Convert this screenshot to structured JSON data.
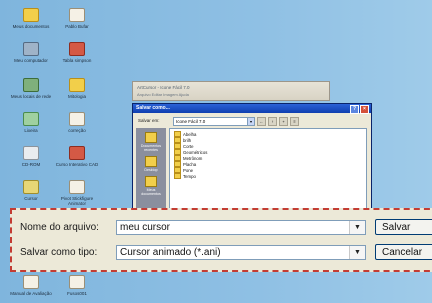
{
  "desktop_icons": [
    {
      "label": "Meus documentos",
      "kind": "folder"
    },
    {
      "label": "Pablo Bufar",
      "kind": "doc"
    },
    {
      "label": "Meu computador",
      "kind": "pc"
    },
    {
      "label": "Tabla simpson",
      "kind": "red"
    },
    {
      "label": "Meus locais de rede",
      "kind": "net"
    },
    {
      "label": "Mitologia",
      "kind": "folder"
    },
    {
      "label": "Lixeira",
      "kind": "trash"
    },
    {
      "label": "correção",
      "kind": "doc"
    },
    {
      "label": "CD-ROM",
      "kind": "cd"
    },
    {
      "label": "Curso Interativo CAD",
      "kind": "red"
    },
    {
      "label": "Cursor",
      "kind": "cursor"
    },
    {
      "label": "Pivot Stickfigure Animator",
      "kind": "doc"
    },
    {
      "label": "Manual de Avaliação",
      "kind": "doc"
    },
    {
      "label": "Fusos001",
      "kind": "doc"
    }
  ],
  "background_window": {
    "title": "ArtCursor - Icone Fácil 7.0",
    "menu": "Arquivo Editar Imagem Ajuda"
  },
  "dialog": {
    "title": "Salvar como...",
    "save_in_label": "Salvar em:",
    "save_in_value": "Icone Fácil 7.0",
    "places": [
      "Documentos recentes",
      "Desktop",
      "Meus documentos"
    ],
    "files": [
      "Abelha",
      "brilh",
      "Corte",
      "Geométricos",
      "Metrônom",
      "Placha",
      "Pone",
      "Tempo"
    ],
    "filename_label": "Nome do arquivo:",
    "filename_value": "meu cursor",
    "filetype_label": "Salvar como tipo:",
    "filetype_value": "Cursor animado (*.ani)",
    "save_button": "Salvar",
    "cancel_button": "Cancelar"
  },
  "colors": {
    "highlight_border": "#c33c33",
    "desktop": "#8fc0e4",
    "titlebar": "#0f3fb0"
  }
}
